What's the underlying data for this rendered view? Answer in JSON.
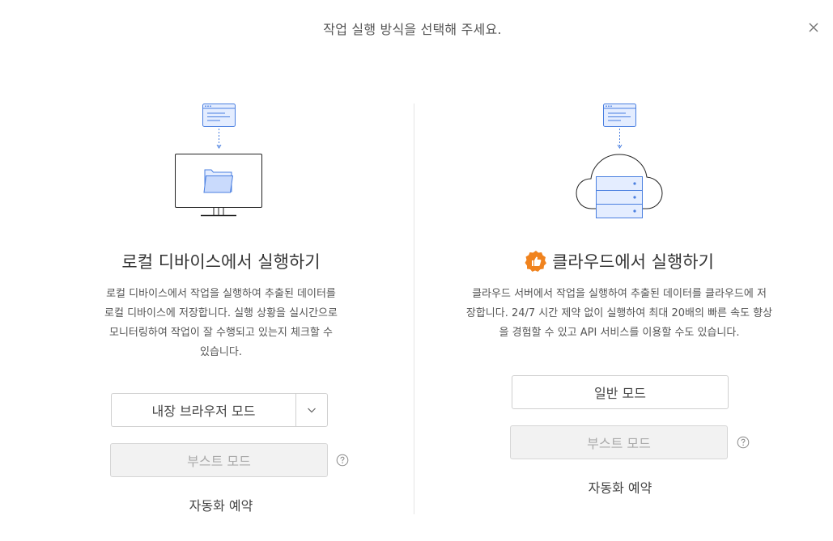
{
  "header": {
    "title": "작업 실행 방식을 선택해 주세요."
  },
  "local": {
    "title": "로컬 디바이스에서 실행하기",
    "description_lines": [
      "로컬 디바이스에서 작업을 실행하여 추출된 데이터를",
      "로컬 디바이스에 저장합니다. 실행 상황을 실시간으로",
      "모니터링하여 작업이 잘 수행되고 있는지 체크할 수",
      "있습니다."
    ],
    "mode_select_label": "내장 브라우저 모드",
    "boost_mode_label": "부스트 모드",
    "schedule_label": "자동화 예약"
  },
  "cloud": {
    "title": "클라우드에서 실행하기",
    "description_lines": [
      "클라우드 서버에서 작업을 실행하여 추출된 데이터를 클라우드에 저",
      "장합니다. 24/7 시간 제약 없이 실행하여 최대 20배의 빠른 속도 향상",
      "을 경험할 수 있고 API 서비스를 이용할 수도 있습니다."
    ],
    "normal_mode_label": "일반 모드",
    "boost_mode_label": "부스트 모드",
    "schedule_label": "자동화 예약"
  },
  "icons": {
    "close": "close-icon",
    "chevron": "chevron-down-icon",
    "help": "question-circle-icon",
    "premium": "thumbs-up-badge-icon",
    "monitor": "monitor-folder-icon",
    "cloud": "cloud-server-icon"
  },
  "colors": {
    "accent_blue": "#4a7fe0",
    "light_blue_fill": "#e4edff",
    "badge_orange": "#f0831e"
  }
}
